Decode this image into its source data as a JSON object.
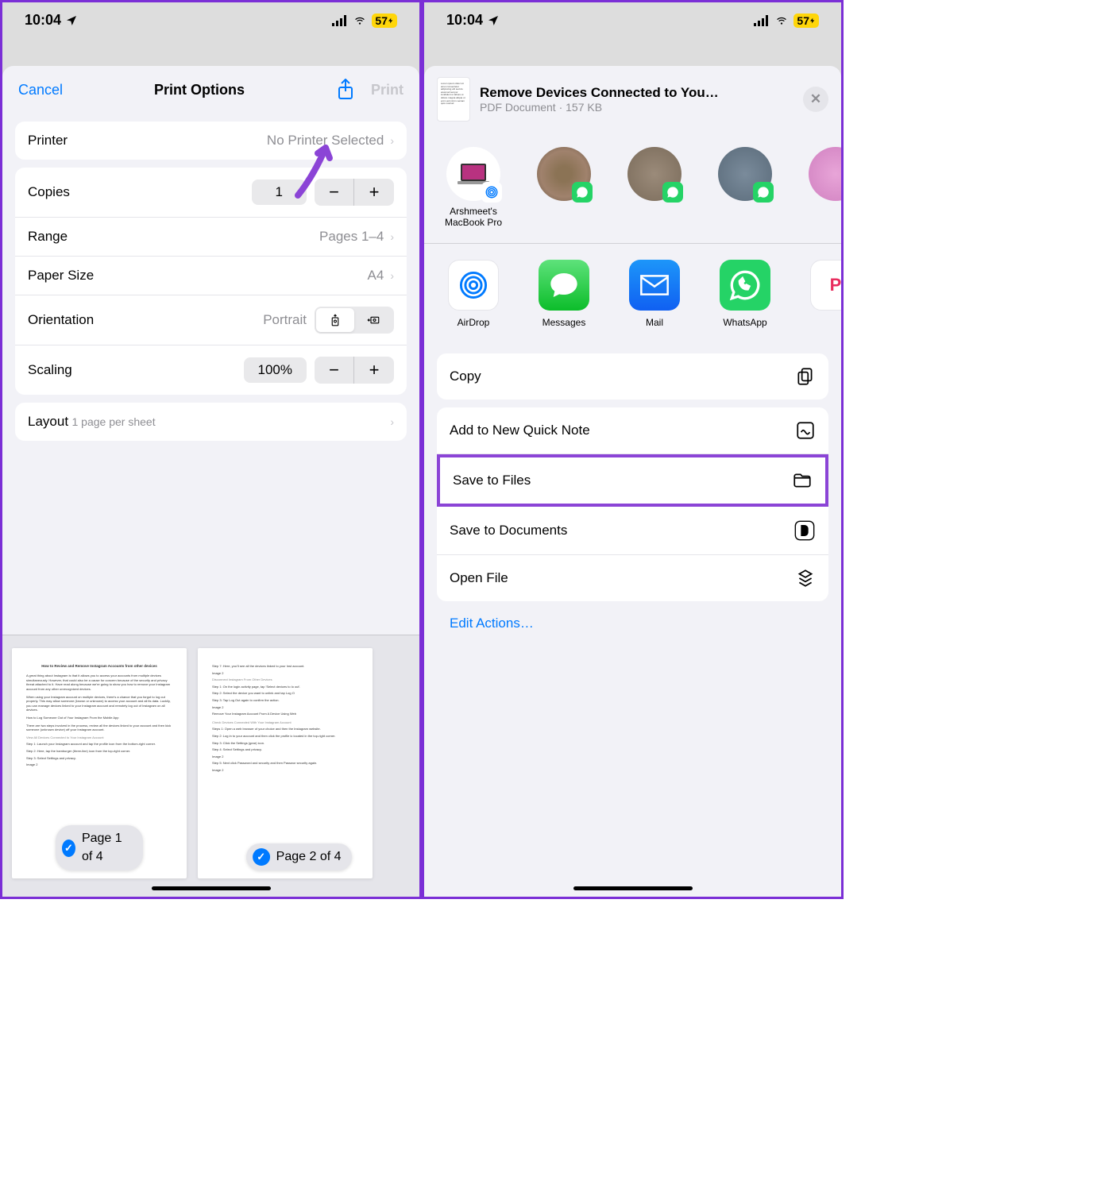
{
  "status": {
    "time": "10:04",
    "battery": "57"
  },
  "left": {
    "cancel": "Cancel",
    "title": "Print Options",
    "print": "Print",
    "printer": {
      "label": "Printer",
      "value": "No Printer Selected"
    },
    "copies": {
      "label": "Copies",
      "value": "1"
    },
    "range": {
      "label": "Range",
      "value": "Pages 1–4"
    },
    "paper": {
      "label": "Paper Size",
      "value": "A4"
    },
    "orientation": {
      "label": "Orientation",
      "value": "Portrait"
    },
    "scaling": {
      "label": "Scaling",
      "value": "100%"
    },
    "layout": {
      "label": "Layout",
      "sub": "1 page per sheet"
    },
    "page1": "Page 1 of 4",
    "page2": "Page 2 of 4"
  },
  "right": {
    "docTitle": "Remove Devices Connected to You…",
    "docMeta": "PDF Document · 157 KB",
    "contact1": "Arshmeet's MacBook Pro",
    "apps": {
      "airdrop": "AirDrop",
      "messages": "Messages",
      "mail": "Mail",
      "whatsapp": "WhatsApp"
    },
    "actions": {
      "copy": "Copy",
      "quicknote": "Add to New Quick Note",
      "savefiles": "Save to Files",
      "savedocs": "Save to Documents",
      "openfile": "Open File"
    },
    "edit": "Edit Actions…"
  }
}
